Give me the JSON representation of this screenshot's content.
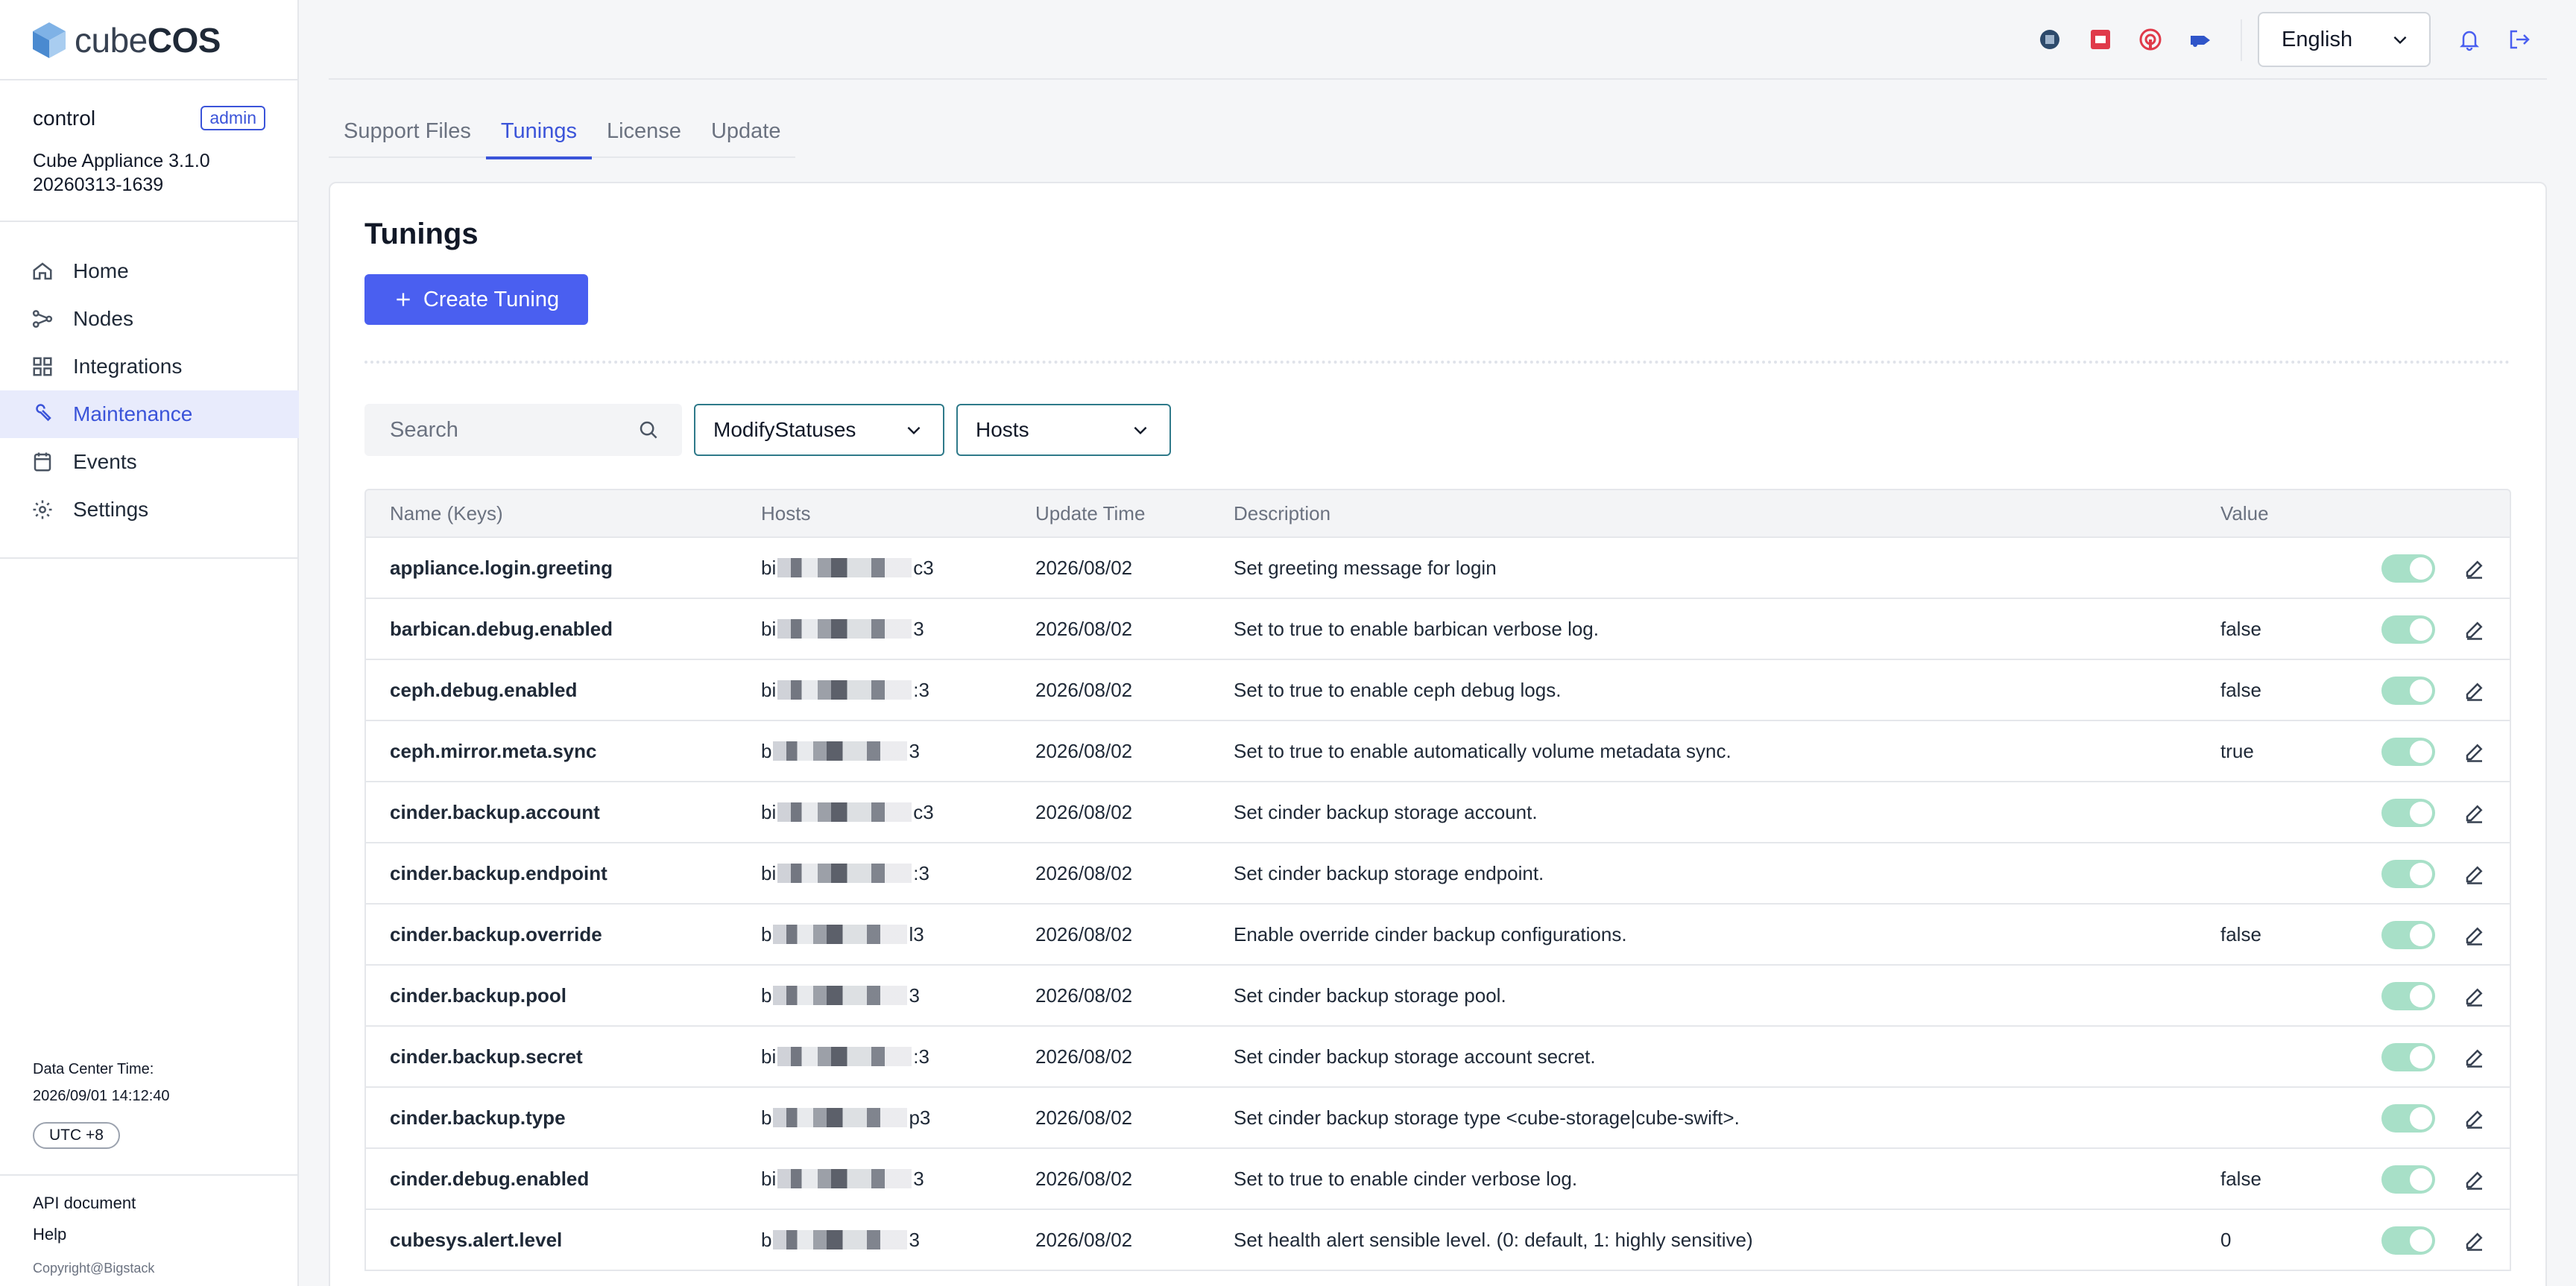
{
  "brand": {
    "name_light": "cube",
    "name_bold": "COS"
  },
  "user": {
    "name": "control",
    "role": "admin"
  },
  "appliance": {
    "version": "Cube Appliance 3.1.0",
    "build": "20260313-1639"
  },
  "nav": [
    {
      "label": "Home",
      "icon": "home-icon"
    },
    {
      "label": "Nodes",
      "icon": "nodes-icon"
    },
    {
      "label": "Integrations",
      "icon": "integrations-icon"
    },
    {
      "label": "Maintenance",
      "icon": "maintenance-icon",
      "active": true
    },
    {
      "label": "Events",
      "icon": "events-icon"
    },
    {
      "label": "Settings",
      "icon": "gear-icon"
    }
  ],
  "datacenter": {
    "label": "Data Center Time:",
    "time": "2026/09/01 14:12:40",
    "timezone": "UTC +8"
  },
  "footer": {
    "api_doc": "API document",
    "help": "Help",
    "copyright": "Copyright@Bigstack"
  },
  "header": {
    "language": "English",
    "icons": [
      "openstack-icon",
      "ceph-icon",
      "grafana-icon",
      "kubernetes-icon",
      "notification-icon",
      "logout-icon"
    ]
  },
  "tabs": [
    "Support Files",
    "Tunings",
    "License",
    "Update"
  ],
  "active_tab": "Tunings",
  "page": {
    "title": "Tunings",
    "create_button": "Create Tuning"
  },
  "filters": {
    "search_placeholder": "Search",
    "status_dropdown": "ModifyStatuses",
    "hosts_dropdown": "Hosts"
  },
  "table": {
    "columns": [
      "Name (Keys)",
      "Hosts",
      "Update Time",
      "Description",
      "Value"
    ],
    "rows": [
      {
        "key": "appliance.login.greeting",
        "host_prefix": "bi",
        "host_suffix": "c3",
        "updated": "2026/08/02",
        "description": "Set greeting message for login",
        "value": ""
      },
      {
        "key": "barbican.debug.enabled",
        "host_prefix": "bi",
        "host_suffix": "3",
        "updated": "2026/08/02",
        "description": "Set to true to enable barbican verbose log.",
        "value": "false"
      },
      {
        "key": "ceph.debug.enabled",
        "host_prefix": "bi",
        "host_suffix": ":3",
        "updated": "2026/08/02",
        "description": "Set to true to enable ceph debug logs.",
        "value": "false"
      },
      {
        "key": "ceph.mirror.meta.sync",
        "host_prefix": "b",
        "host_suffix": "3",
        "updated": "2026/08/02",
        "description": "Set to true to enable automatically volume metadata sync.",
        "value": "true"
      },
      {
        "key": "cinder.backup.account",
        "host_prefix": "bi",
        "host_suffix": "c3",
        "updated": "2026/08/02",
        "description": "Set cinder backup storage account.",
        "value": ""
      },
      {
        "key": "cinder.backup.endpoint",
        "host_prefix": "bi",
        "host_suffix": ":3",
        "updated": "2026/08/02",
        "description": "Set cinder backup storage endpoint.",
        "value": ""
      },
      {
        "key": "cinder.backup.override",
        "host_prefix": "b",
        "host_suffix": "l3",
        "updated": "2026/08/02",
        "description": "Enable override cinder backup configurations.",
        "value": "false"
      },
      {
        "key": "cinder.backup.pool",
        "host_prefix": "b",
        "host_suffix": "3",
        "updated": "2026/08/02",
        "description": "Set cinder backup storage pool.",
        "value": ""
      },
      {
        "key": "cinder.backup.secret",
        "host_prefix": "bi",
        "host_suffix": ":3",
        "updated": "2026/08/02",
        "description": "Set cinder backup storage account secret.",
        "value": ""
      },
      {
        "key": "cinder.backup.type",
        "host_prefix": "b",
        "host_suffix": "p3",
        "updated": "2026/08/02",
        "description": "Set cinder backup storage type <cube-storage|cube-swift>.",
        "value": ""
      },
      {
        "key": "cinder.debug.enabled",
        "host_prefix": "bi",
        "host_suffix": "3",
        "updated": "2026/08/02",
        "description": "Set to true to enable cinder verbose log.",
        "value": "false"
      },
      {
        "key": "cubesys.alert.level",
        "host_prefix": "b",
        "host_suffix": "3",
        "updated": "2026/08/02",
        "description": "Set health alert sensible level. (0: default, 1: highly sensitive)",
        "value": "0"
      }
    ]
  },
  "colors": {
    "accent": "#4a5ff0",
    "active_nav_bg": "#e8ebfc",
    "toggle_on": "#a8e0c8",
    "dropdown_border": "#2f7a8a"
  }
}
